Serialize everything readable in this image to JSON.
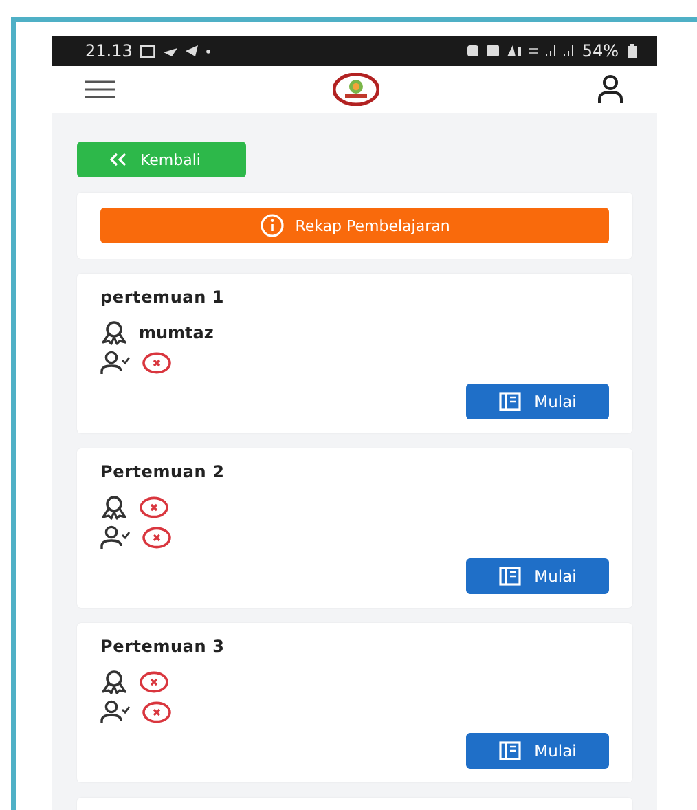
{
  "status_bar": {
    "time": "21.13",
    "battery": "54%"
  },
  "back_button": {
    "label": "Kembali"
  },
  "recap_button": {
    "label": "Rekap Pembelajaran"
  },
  "meetings": [
    {
      "title": "pertemuan 1",
      "teacher": "mumtaz",
      "attended": false,
      "button": "Mulai"
    },
    {
      "title": "Pertemuan 2",
      "attended": false,
      "button": "Mulai"
    },
    {
      "title": "Pertemuan 3",
      "attended": false,
      "button": "Mulai"
    }
  ]
}
